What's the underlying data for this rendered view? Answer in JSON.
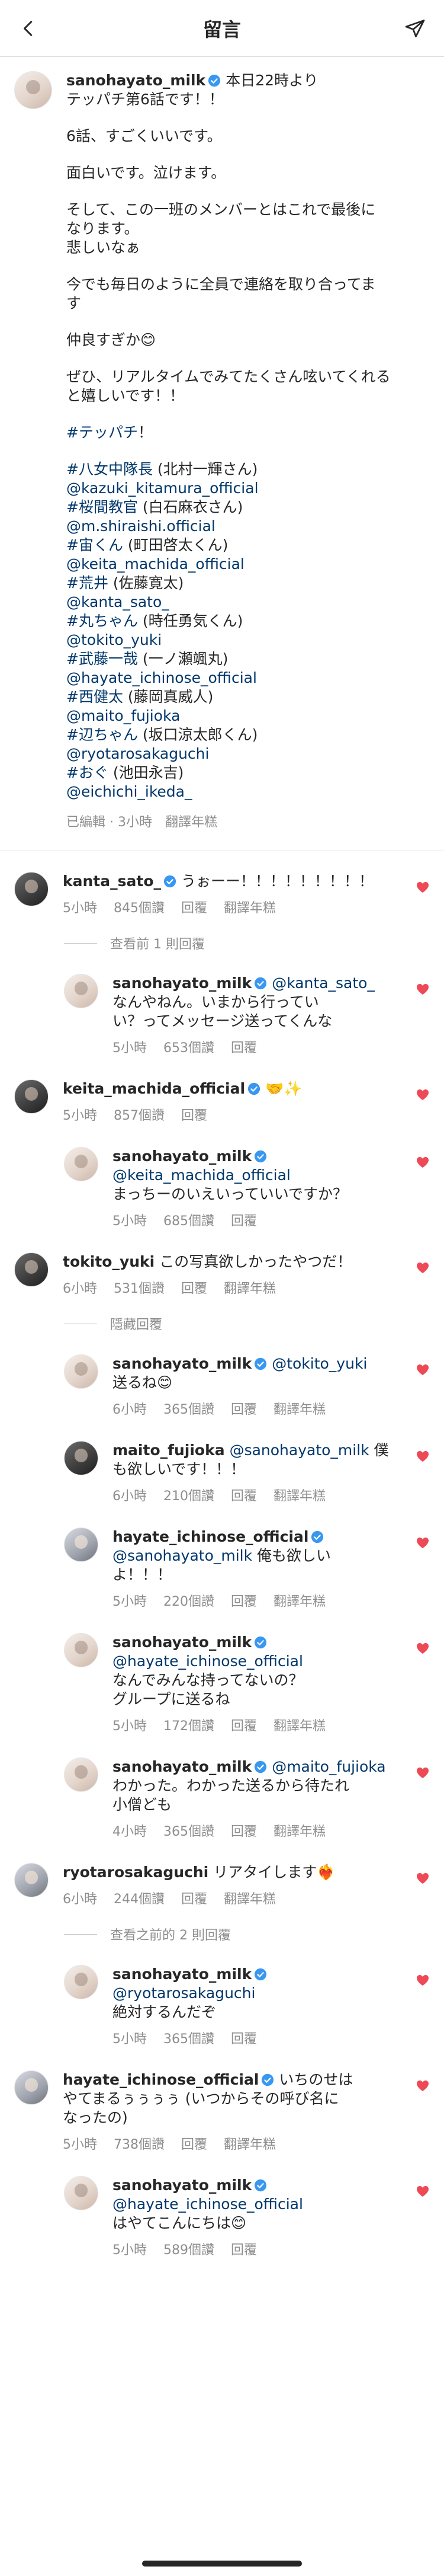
{
  "header": {
    "title": "留言"
  },
  "post": {
    "username": "sanohayato_milk",
    "caption": [
      [
        {
          "t": "本日22時より"
        }
      ],
      [
        {
          "t": "テッパチ第6話です！！"
        }
      ],
      "gap",
      [
        {
          "t": "6話、すごくいいです。"
        }
      ],
      "gap",
      [
        {
          "t": "面白いです。泣けます。"
        }
      ],
      "gap",
      [
        {
          "t": "そして、この一班のメンバーとはこれで最後に"
        }
      ],
      [
        {
          "t": "なります。"
        }
      ],
      [
        {
          "t": "悲しいなぁ"
        }
      ],
      "gap",
      [
        {
          "t": "今でも毎日のように全員で連絡を取り合ってま"
        }
      ],
      [
        {
          "t": "す"
        }
      ],
      "gap",
      [
        {
          "t": "仲良すぎか😊"
        }
      ],
      "gap",
      [
        {
          "t": "ぜひ、リアルタイムでみてたくさん呟いてくれる"
        }
      ],
      [
        {
          "t": "と嬉しいです！！"
        }
      ],
      "gap",
      [
        {
          "t": "#テッパチ",
          "link": true
        },
        {
          "t": "！"
        }
      ],
      "gap",
      [
        {
          "t": "#八女中隊長",
          "link": true
        },
        {
          "t": " (北村一輝さん)"
        }
      ],
      [
        {
          "t": "@kazuki_kitamura_official",
          "link": true
        }
      ],
      [
        {
          "t": "#桜間教官",
          "link": true
        },
        {
          "t": " (白石麻衣さん)"
        }
      ],
      [
        {
          "t": "@m.shiraishi.official",
          "link": true
        }
      ],
      [
        {
          "t": "#宙くん",
          "link": true
        },
        {
          "t": " (町田啓太くん)"
        }
      ],
      [
        {
          "t": "@keita_machida_official",
          "link": true
        }
      ],
      [
        {
          "t": "#荒井",
          "link": true
        },
        {
          "t": " (佐藤寛太)"
        }
      ],
      [
        {
          "t": "@kanta_sato_",
          "link": true
        }
      ],
      [
        {
          "t": "#丸ちゃん",
          "link": true
        },
        {
          "t": " (時任勇気くん)"
        }
      ],
      [
        {
          "t": "@tokito_yuki",
          "link": true
        }
      ],
      [
        {
          "t": "#武藤一哉",
          "link": true
        },
        {
          "t": " (一ノ瀬颯丸)"
        }
      ],
      [
        {
          "t": "@hayate_ichinose_official",
          "link": true
        }
      ],
      [
        {
          "t": "#西健太",
          "link": true
        },
        {
          "t": " (藤岡真威人)"
        }
      ],
      [
        {
          "t": "@maito_fujioka",
          "link": true
        }
      ],
      [
        {
          "t": "#辺ちゃん",
          "link": true
        },
        {
          "t": " (坂口涼太郎くん)"
        }
      ],
      [
        {
          "t": "@ryotarosakaguchi",
          "link": true
        }
      ],
      [
        {
          "t": "#おぐ",
          "link": true
        },
        {
          "t": " (池田永吉)"
        }
      ],
      [
        {
          "t": "@eichichi_ikeda_",
          "link": true
        }
      ]
    ],
    "meta": [
      "已編輯 · 3小時",
      "翻譯年糕"
    ]
  },
  "comments": [
    {
      "type": "comment",
      "avatar": "dark",
      "username": "kanta_sato_",
      "verified": true,
      "lines": [
        [
          {
            "t": "うぉーー！！！！！！！！！"
          }
        ]
      ],
      "meta": [
        "5小時",
        "845個讚",
        "回覆",
        "翻譯年糕"
      ]
    },
    {
      "type": "thread",
      "text": "查看前 1 則回覆"
    },
    {
      "type": "reply",
      "avatar": "light",
      "username": "sanohayato_milk",
      "verified": true,
      "lines": [
        [
          {
            "t": "@kanta_sato_",
            "link": true
          }
        ],
        [
          {
            "t": "なんやねん。いまから行ってい"
          }
        ],
        [
          {
            "t": "い？ってメッセージ送ってくんな"
          }
        ]
      ],
      "meta": [
        "5小時",
        "653個讚",
        "回覆"
      ]
    },
    {
      "type": "comment",
      "avatar": "dark",
      "username": "keita_machida_official",
      "verified": true,
      "lines": [
        [
          {
            "t": "🤝✨"
          }
        ]
      ],
      "meta": [
        "5小時",
        "857個讚",
        "回覆"
      ]
    },
    {
      "type": "reply",
      "avatar": "light",
      "username": "sanohayato_milk",
      "verified": true,
      "lines": [
        [
          {
            "t": "@keita_machida_official",
            "link": true
          }
        ],
        [
          {
            "t": "まっちーのいえいっていいですか？"
          }
        ]
      ],
      "meta": [
        "5小時",
        "685個讚",
        "回覆"
      ]
    },
    {
      "type": "comment",
      "avatar": "dark",
      "username": "tokito_yuki",
      "verified": false,
      "lines": [
        [
          {
            "t": "この写真欲しかったやつだ！"
          }
        ]
      ],
      "meta": [
        "6小時",
        "531個讚",
        "回覆",
        "翻譯年糕"
      ]
    },
    {
      "type": "thread",
      "text": "隱藏回覆"
    },
    {
      "type": "reply",
      "avatar": "light",
      "username": "sanohayato_milk",
      "verified": true,
      "lines": [
        [
          {
            "t": "@tokito_yuki",
            "link": true
          }
        ],
        [
          {
            "t": "送るね😊"
          }
        ]
      ],
      "meta": [
        "6小時",
        "365個讚",
        "回覆",
        "翻譯年糕"
      ]
    },
    {
      "type": "reply",
      "avatar": "dark",
      "username": "maito_fujioka",
      "verified": false,
      "lines": [
        [
          {
            "t": "@sanohayato_milk",
            "link": true
          },
          {
            "t": " 僕"
          }
        ],
        [
          {
            "t": "も欲しいです！！！"
          }
        ]
      ],
      "meta": [
        "6小時",
        "210個讚",
        "回覆",
        "翻譯年糕"
      ]
    },
    {
      "type": "reply",
      "avatar": "mid",
      "username": "hayate_ichinose_official",
      "verified": true,
      "lines": [
        [
          {
            "t": "@sanohayato_milk",
            "link": true
          },
          {
            "t": " 俺も欲しい"
          }
        ],
        [
          {
            "t": "よ！！！"
          }
        ]
      ],
      "meta": [
        "5小時",
        "220個讚",
        "回覆",
        "翻譯年糕"
      ]
    },
    {
      "type": "reply",
      "avatar": "light",
      "username": "sanohayato_milk",
      "verified": true,
      "lines": [
        [
          {
            "t": "@hayate_ichinose_official",
            "link": true
          }
        ],
        [
          {
            "t": "なんでみんな持ってないの？"
          }
        ],
        [
          {
            "t": "グループに送るね"
          }
        ]
      ],
      "meta": [
        "5小時",
        "172個讚",
        "回覆",
        "翻譯年糕"
      ]
    },
    {
      "type": "reply",
      "avatar": "light",
      "username": "sanohayato_milk",
      "verified": true,
      "lines": [
        [
          {
            "t": "@maito_fujioka",
            "link": true
          }
        ],
        [
          {
            "t": "わかった。わかった送るから待たれ"
          }
        ],
        [
          {
            "t": "小僧ども"
          }
        ]
      ],
      "meta": [
        "4小時",
        "365個讚",
        "回覆",
        "翻譯年糕"
      ]
    },
    {
      "type": "comment",
      "avatar": "mid",
      "username": "ryotarosakaguchi",
      "verified": false,
      "lines": [
        [
          {
            "t": "リアタイします❤️‍🔥"
          }
        ]
      ],
      "meta": [
        "6小時",
        "244個讚",
        "回覆",
        "翻譯年糕"
      ]
    },
    {
      "type": "thread",
      "text": "查看之前的 2 則回覆"
    },
    {
      "type": "reply",
      "avatar": "light",
      "username": "sanohayato_milk",
      "verified": true,
      "lines": [
        [
          {
            "t": "@ryotarosakaguchi",
            "link": true
          }
        ],
        [
          {
            "t": "絶対するんだぞ"
          }
        ]
      ],
      "meta": [
        "5小時",
        "365個讚",
        "回覆"
      ]
    },
    {
      "type": "comment",
      "avatar": "mid",
      "username": "hayate_ichinose_official",
      "verified": true,
      "lines": [
        [
          {
            "t": "いちのせは"
          }
        ],
        [
          {
            "t": "やてまるぅぅぅぅ (いつからその呼び名に"
          }
        ],
        [
          {
            "t": "なったの)"
          }
        ]
      ],
      "meta": [
        "5小時",
        "738個讚",
        "回覆",
        "翻譯年糕"
      ]
    },
    {
      "type": "reply",
      "avatar": "light",
      "username": "sanohayato_milk",
      "verified": true,
      "lines": [
        [
          {
            "t": "@hayate_ichinose_official",
            "link": true
          }
        ],
        [
          {
            "t": "はやてこんにちは😊"
          }
        ]
      ],
      "meta": [
        "5小時",
        "589個讚",
        "回覆"
      ]
    }
  ]
}
